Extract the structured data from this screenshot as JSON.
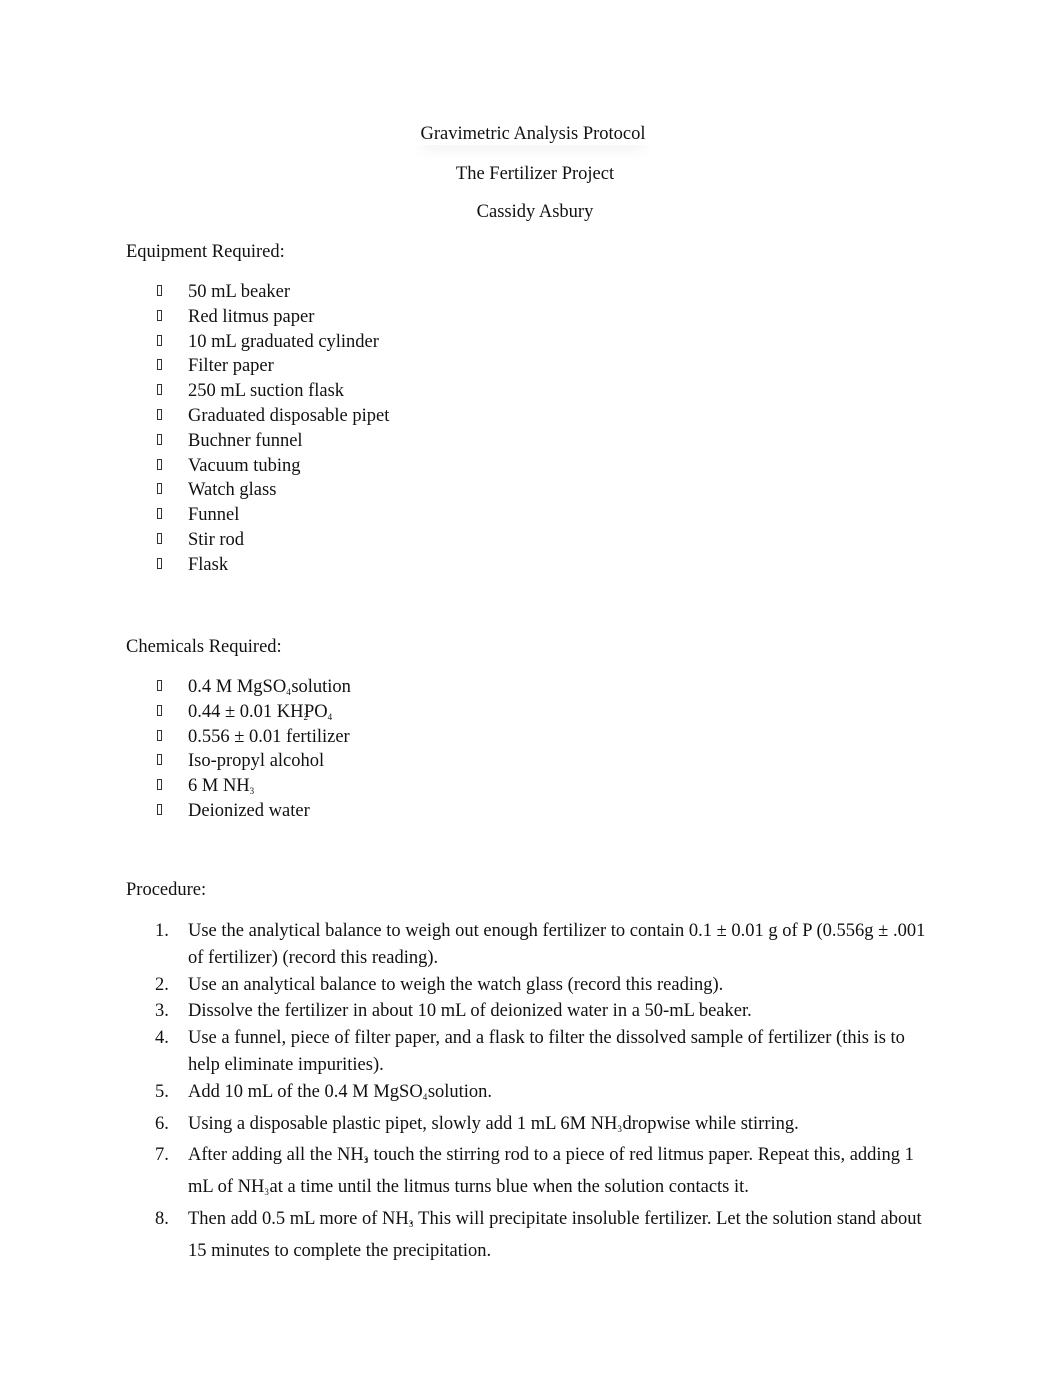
{
  "document": {
    "title": "Gravimetric Analysis Protocol",
    "subtitle": "The Fertilizer Project",
    "author": "Cassidy Asbury"
  },
  "equipment": {
    "heading": "Equipment Required:",
    "items": [
      "50 mL beaker",
      "Red litmus paper",
      "10 mL graduated cylinder",
      "Filter paper",
      "250 mL suction flask",
      "Graduated disposable pipet",
      "Buchner funnel",
      "Vacuum tubing",
      "Watch glass",
      "Funnel",
      "Stir rod",
      "Flask"
    ]
  },
  "chemicals": {
    "heading": "Chemicals Required:",
    "items": [
      {
        "pre": "0.4 M MgSO",
        "sub": "4",
        "post": " solution"
      },
      {
        "pre": "0.44 ± 0.01 KH",
        "sub": "2",
        "post": "PO",
        "sub2": "4"
      },
      {
        "pre": "0.556 ± 0.01 fertilizer",
        "sub": "",
        "post": ""
      },
      {
        "pre": "Iso-propyl alcohol",
        "sub": "",
        "post": ""
      },
      {
        "pre": "6 M NH",
        "sub": "3",
        "post": ""
      },
      {
        "pre": "Deionized water",
        "sub": "",
        "post": ""
      }
    ]
  },
  "procedure": {
    "heading": "Procedure:",
    "steps": [
      {
        "num": "1.",
        "pre": "Use the analytical balance to weigh out enough fertilizer to contain 0.1 ± 0.01 g of P (0.556g ± .001 of fertilizer) (record this reading).",
        "sub": "",
        "post": ""
      },
      {
        "num": "2.",
        "pre": "Use an analytical balance to weigh the watch glass (record this reading).",
        "sub": "",
        "post": ""
      },
      {
        "num": "3.",
        "pre": "Dissolve the fertilizer in about 10 mL of deionized water in a 50-mL beaker.",
        "sub": "",
        "post": ""
      },
      {
        "num": "4.",
        "pre": "Use a funnel, piece of filter paper, and a flask to filter the dissolved sample of fertilizer (this is to help eliminate impurities).",
        "sub": "",
        "post": ""
      },
      {
        "num": "5.",
        "pre": "Add 10 mL of the 0.4 M MgSO",
        "sub": "4",
        "post": " solution."
      },
      {
        "num": "6.",
        "pre": "Using a disposable plastic pipet, slowly add 1 mL 6M NH",
        "sub": "3",
        "post": " dropwise while stirring."
      },
      {
        "num": "7.",
        "pre": "After adding all the NH",
        "sub": "3",
        "post": ", touch the stirring rod to a piece of red litmus paper. Repeat this, adding 1   mL of NH",
        "sub2": "3",
        "post2": " at a time until the litmus turns blue when the solution contacts it."
      },
      {
        "num": "8.",
        "pre": "Then add 0.5 mL more of NH",
        "sub": "3",
        "post": ". This will precipitate insoluble fertilizer. Let the solution stand about 15 minutes to complete the precipitation."
      }
    ]
  }
}
